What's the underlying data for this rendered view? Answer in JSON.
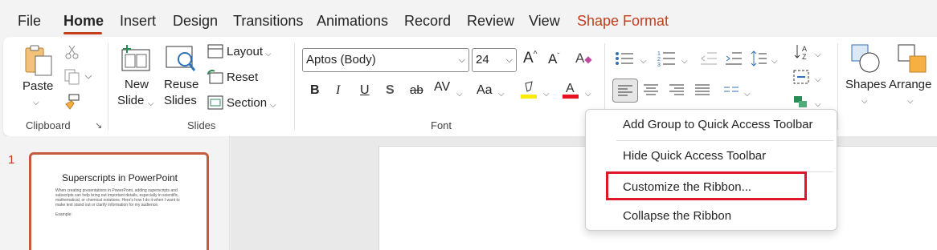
{
  "tabs": [
    {
      "label": "File"
    },
    {
      "label": "Home"
    },
    {
      "label": "Insert"
    },
    {
      "label": "Design"
    },
    {
      "label": "Transitions"
    },
    {
      "label": "Animations"
    },
    {
      "label": "Record"
    },
    {
      "label": "Review"
    },
    {
      "label": "View"
    },
    {
      "label": "Shape Format"
    }
  ],
  "ribbon": {
    "clipboard": {
      "paste": "Paste",
      "group": "Clipboard"
    },
    "slides": {
      "new_line1": "New",
      "new_line2": "Slide",
      "reuse_line1": "Reuse",
      "reuse_line2": "Slides",
      "layout": "Layout",
      "reset": "Reset",
      "section": "Section",
      "group": "Slides"
    },
    "font": {
      "face": "Aptos (Body)",
      "size": "24",
      "group": "Font",
      "case_label": "Aa",
      "spacing_label": "AV"
    },
    "drawing": {
      "shapes": "Shapes",
      "arrange": "Arrange"
    },
    "colors": {
      "accent": "#c43e1c",
      "highlight_yellow": "#ffeb00",
      "font_red": "#e81123",
      "callout_red": "#e0172b"
    }
  },
  "slide_panel": {
    "number": "1",
    "thumb_title": "Superscripts in PowerPoint",
    "thumb_body": "When creating presentations in PowerPoint, adding superscripts and subscripts can help bring out important details, especially in scientific, mathematical, or chemical notations. Here's how I do it when I want to make text stand out or clarify information for my audience.",
    "thumb_example": "Example:"
  },
  "context_menu": {
    "items": [
      {
        "label": "Add Group to Quick Access Toolbar"
      },
      {
        "label": "Hide Quick Access Toolbar"
      },
      {
        "label": "Customize the Ribbon..."
      },
      {
        "label": "Collapse the Ribbon"
      }
    ]
  }
}
